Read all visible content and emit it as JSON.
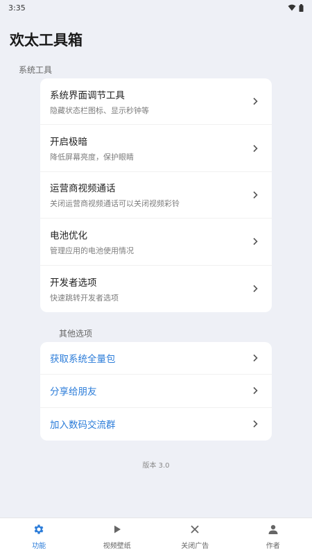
{
  "status_bar": {
    "time": "3:35"
  },
  "app": {
    "title": "欢太工具箱"
  },
  "system_tools": {
    "header": "系统工具",
    "items": [
      {
        "title": "系统界面调节工具",
        "subtitle": "隐藏状态栏图标、显示秒钟等"
      },
      {
        "title": "开启极暗",
        "subtitle": "降低屏幕亮度，保护眼睛"
      },
      {
        "title": "运营商视频通话",
        "subtitle": "关闭运营商视频通话可以关闭视频彩铃"
      },
      {
        "title": "电池优化",
        "subtitle": "管理应用的电池使用情况"
      },
      {
        "title": "开发者选项",
        "subtitle": "快速跳转开发者选项"
      }
    ]
  },
  "other_options": {
    "header": "其他选项",
    "items": [
      {
        "title": "获取系统全量包"
      },
      {
        "title": "分享给朋友"
      },
      {
        "title": "加入数码交流群"
      }
    ]
  },
  "version": "版本 3.0",
  "bottom_nav": {
    "items": [
      {
        "label": "功能",
        "icon": "gear-icon",
        "active": true
      },
      {
        "label": "视频壁纸",
        "icon": "play-icon",
        "active": false
      },
      {
        "label": "关闭广告",
        "icon": "close-icon",
        "active": false
      },
      {
        "label": "作者",
        "icon": "person-icon",
        "active": false
      }
    ]
  },
  "colors": {
    "accent": "#2b7cd9",
    "background": "#eef0f6",
    "card": "#ffffff"
  }
}
